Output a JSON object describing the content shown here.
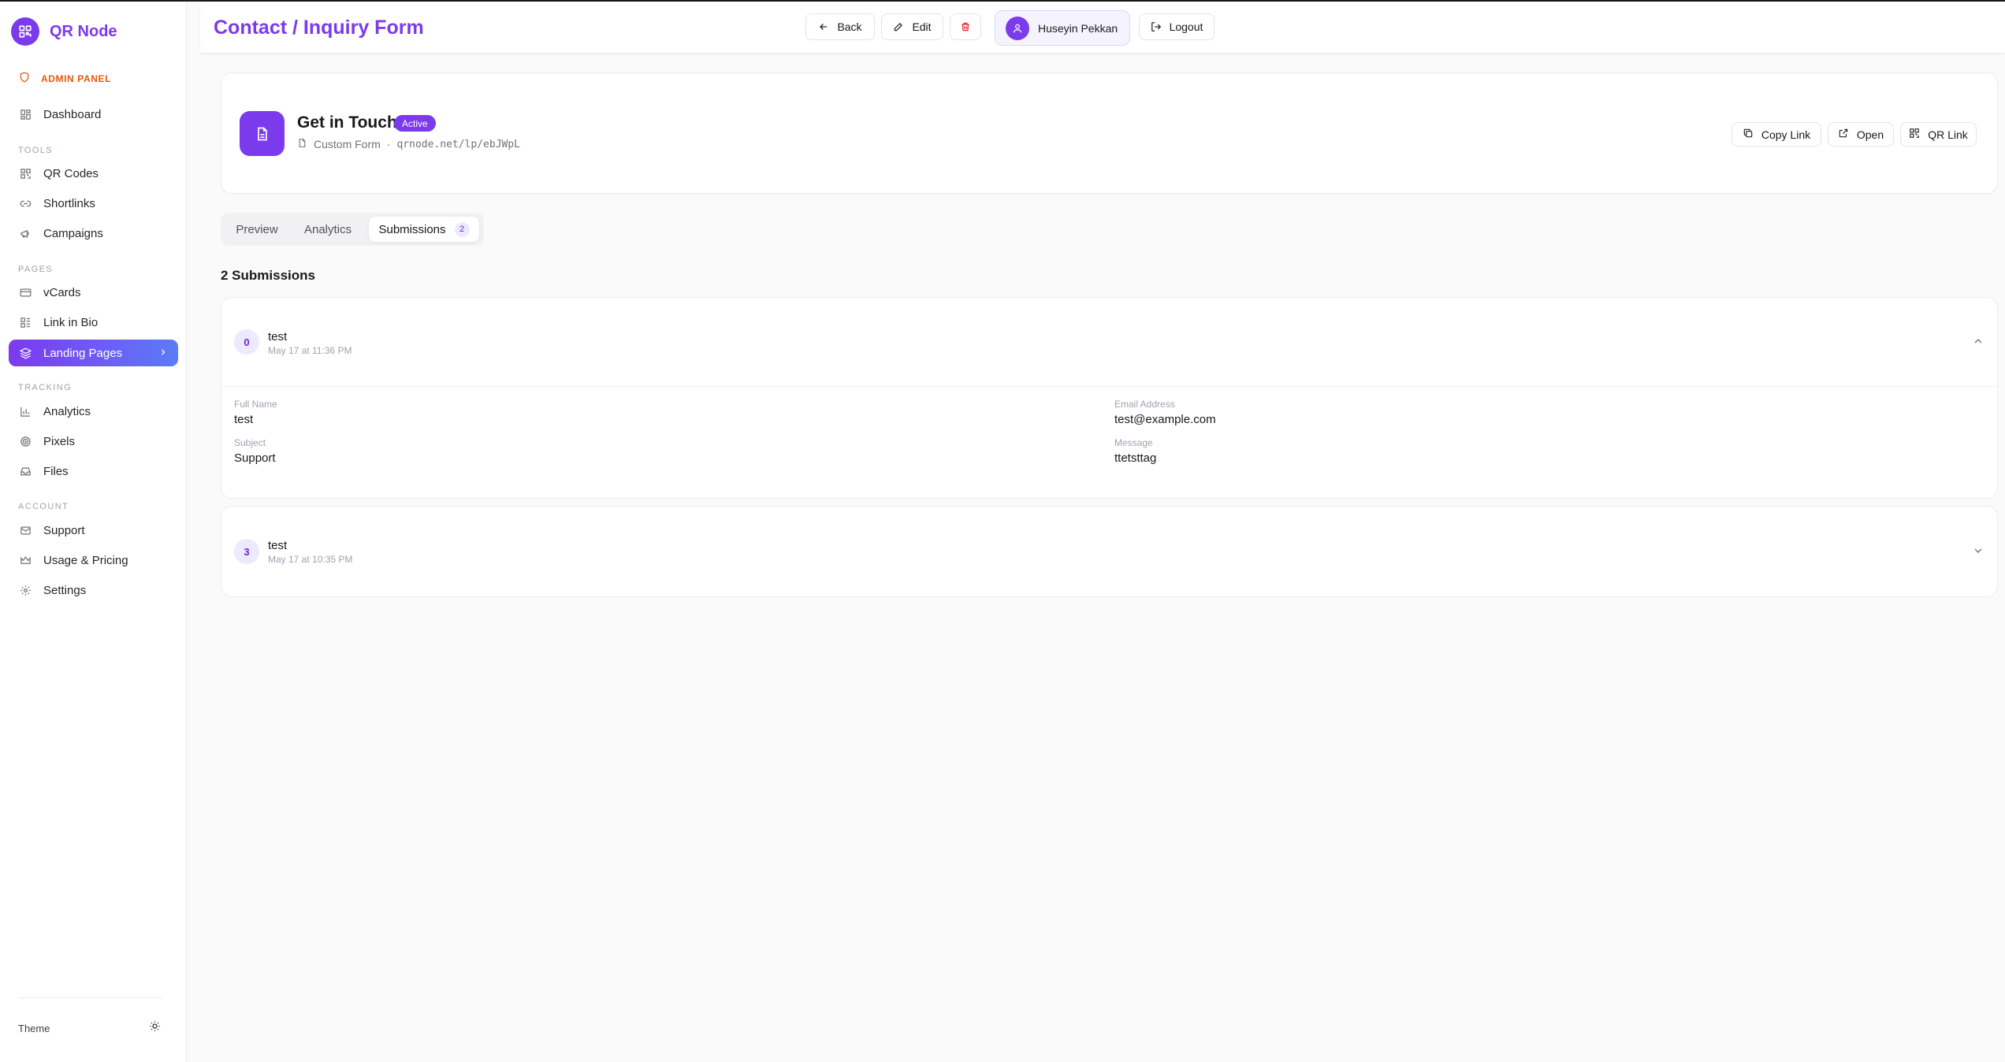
{
  "app": {
    "name": "QR Node",
    "admin_label": "ADMIN PANEL"
  },
  "sidebar": {
    "dashboard": "Dashboard",
    "sections": {
      "tools": "TOOLS",
      "pages": "PAGES",
      "tracking": "TRACKING",
      "account": "ACCOUNT"
    },
    "items": {
      "qr_codes": "QR Codes",
      "shortlinks": "Shortlinks",
      "campaigns": "Campaigns",
      "vcards": "vCards",
      "link_in_bio": "Link in Bio",
      "landing_pages": "Landing Pages",
      "analytics": "Analytics",
      "pixels": "Pixels",
      "files": "Files",
      "support": "Support",
      "usage_pricing": "Usage & Pricing",
      "settings": "Settings"
    },
    "active_item": "landing_pages",
    "theme_label": "Theme"
  },
  "header": {
    "title": "Contact / Inquiry Form",
    "back_label": "Back",
    "edit_label": "Edit",
    "user_name": "Huseyin Pekkan",
    "logout_label": "Logout"
  },
  "page": {
    "title": "Get in Touch",
    "status": "Active",
    "type": "Custom Form",
    "separator": "·",
    "url": "qrnode.net/lp/ebJWpL",
    "copy_link_label": "Copy Link",
    "open_label": "Open",
    "qr_link_label": "QR Link"
  },
  "tabs": {
    "preview": "Preview",
    "analytics": "Analytics",
    "submissions": "Submissions",
    "submissions_count": "2",
    "active": "submissions"
  },
  "submissions": {
    "heading": "2 Submissions",
    "items": [
      {
        "number": "0",
        "name": "test",
        "time": "May 17 at 11:36 PM",
        "expanded": true,
        "fields": [
          {
            "label": "Full Name",
            "value": "test"
          },
          {
            "label": "Email Address",
            "value": "test@example.com"
          },
          {
            "label": "Subject",
            "value": "Support"
          },
          {
            "label": "Message",
            "value": "ttetsttag"
          }
        ]
      },
      {
        "number": "3",
        "name": "test",
        "time": "May 17 at 10:35 PM",
        "expanded": false
      }
    ]
  },
  "colors": {
    "brand": "#7c3aed",
    "admin_accent": "#ea580c",
    "delete": "#dc2626"
  }
}
